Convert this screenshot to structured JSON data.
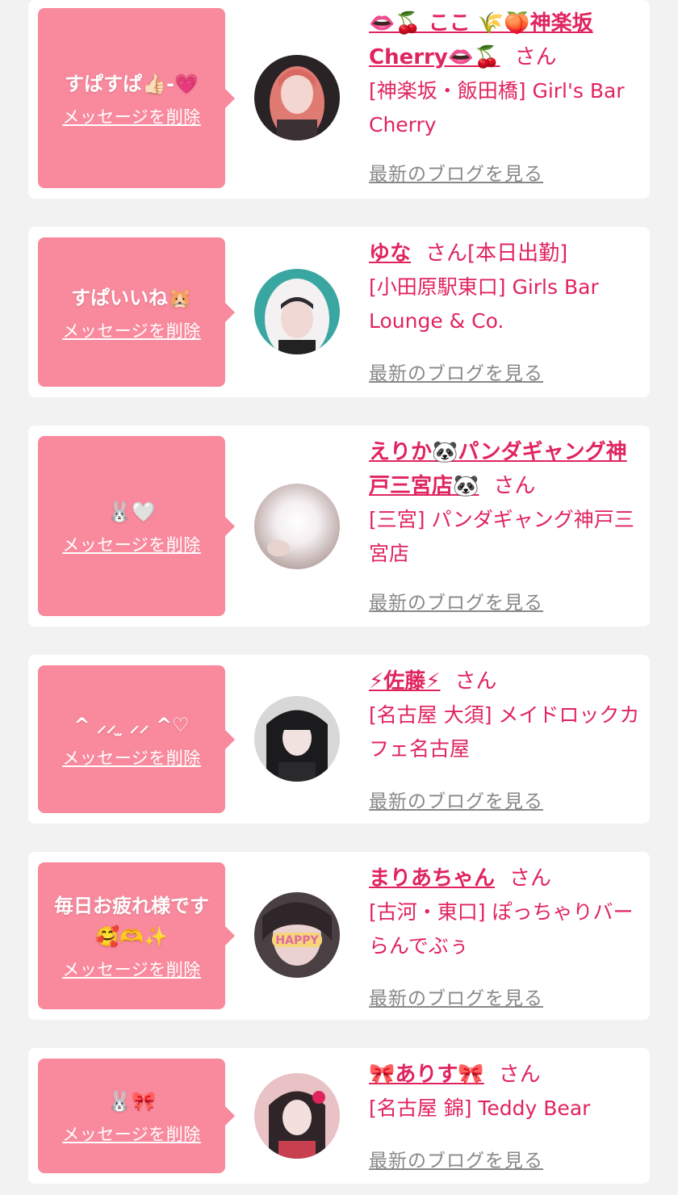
{
  "delete_label": "メッセージを削除",
  "blog_label": "最新のブログを見る",
  "san_label": "さん",
  "colors": {
    "background": "#f2f2f2",
    "card": "#ffffff",
    "bubble": "#f9899d",
    "accent": "#e0245e",
    "muted": "#888888"
  },
  "items": [
    {
      "message": "すぱすぱ👍🏻-💗",
      "name": "👄🍒 ここ 🌾🍑神楽坂Cherry👄🍒",
      "status": "",
      "shop": "[神楽坂・飯田橋] Girl's Bar Cherry",
      "avatar_icon": "avatar-photo-pink-hair"
    },
    {
      "message": "すぱいいね🐹",
      "name": "ゆな",
      "status": "[本日出勤]",
      "shop": "[小田原駅東口] Girls Bar Lounge & Co.",
      "avatar_icon": "avatar-photo-bunny-hood"
    },
    {
      "message": "🐰🤍",
      "name": "えりか🐼パンダギャング神戸三宮店🐼",
      "status": "",
      "shop": "[三宮] パンダギャング神戸三宮店",
      "avatar_icon": "avatar-photo-blurred"
    },
    {
      "message": "^ ⸝⸝ ̫ ⸝⸝ ^♡",
      "name": "⚡佐藤⚡",
      "status": "",
      "shop": "[名古屋 大須] メイドロックカフェ名古屋",
      "avatar_icon": "avatar-photo-black-hair"
    },
    {
      "message": "毎日お疲れ様です🥰🫶✨",
      "name": "まりあちゃん",
      "status": "",
      "shop": "[古河・東口] ぽっちゃりバー らんでぶぅ",
      "avatar_icon": "avatar-photo-happy"
    },
    {
      "message": "🐰🎀",
      "name": "🎀ありす🎀",
      "status": "",
      "shop": "[名古屋 錦] Teddy Bear",
      "avatar_icon": "avatar-photo-pink-ribbon"
    }
  ]
}
